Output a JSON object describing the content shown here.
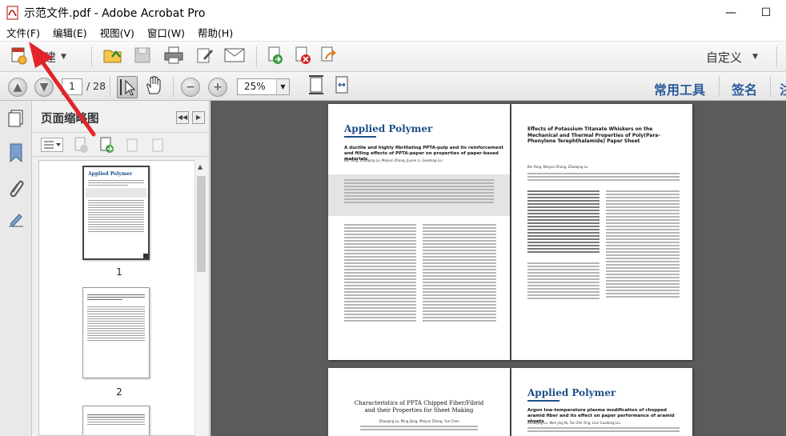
{
  "window": {
    "title": "示范文件.pdf - Adobe Acrobat Pro",
    "minimize": "—",
    "maximize": "☐"
  },
  "menu": [
    "文件(F)",
    "编辑(E)",
    "视图(V)",
    "窗口(W)",
    "帮助(H)"
  ],
  "toolbar": {
    "create_label": "创建",
    "customize_label": "自定义"
  },
  "nav": {
    "current_page": "1",
    "total_pages": "/ 28",
    "zoom": "25%",
    "common_tools": "常用工具",
    "sign": "签名",
    "comment": "注"
  },
  "thumbnails": {
    "title": "页面缩略图",
    "pages": [
      {
        "num": "1"
      },
      {
        "num": "2"
      },
      {
        "num": ""
      }
    ]
  },
  "document": {
    "page1": {
      "journal": "Applied Polymer",
      "title": "A ductile and highly fibrillating PPTA-pulp and its reinforcement and filling effects of PPTA-paper on properties of paper-based materials",
      "authors": "Bin Yang, Zhaoqing Lu, Meiyun Zhang, Jiyuan Li, Guodong Liu"
    },
    "page2": {
      "title": "Effects of Potassium Titanate Whiskers on the Mechanical and Thermal Properties of Poly(Para-Phenylene Terephthalamide) Paper Sheet",
      "authors": "Bin Yang, Meiyun Zhang, Zhaoqing Lu"
    },
    "page3": {
      "title": "Characteristics of PPTA Chipped Fiber/Fibrid and their Properties for Sheet Making",
      "authors": "Zhaoqing Lu, Ming Jiang, Meiyun Zhang, Yue Chen"
    },
    "page4": {
      "journal": "Applied Polymer",
      "title": "Argon low-temperature plasma modification of chopped aramid fiber and its effect on paper performance of aramid sheets",
      "authors": "Zhaoqing Lu, Wen Jing Ni, Fan Zhe Ying, Lian Guodong Liu"
    }
  },
  "colors": {
    "accent_blue": "#2b5b9a",
    "journal_blue": "#1d4f8a",
    "arrow_red": "#e2242a",
    "doc_background": "#5b5b5b"
  }
}
